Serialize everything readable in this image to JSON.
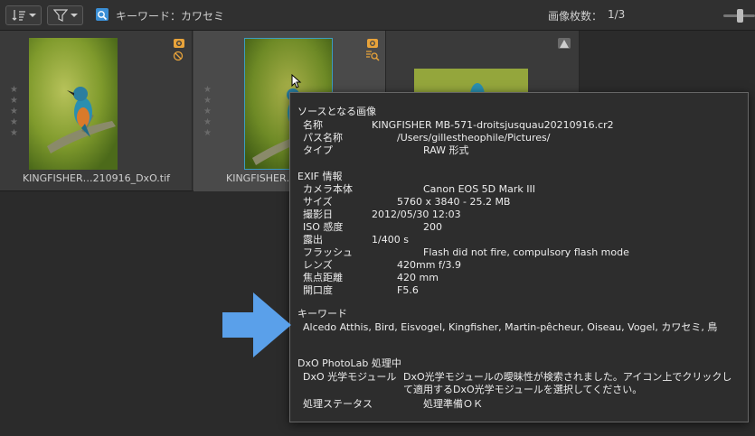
{
  "toolbar": {
    "keyword_label": "キーワード：カワセミ",
    "image_count_label": "画像枚数：",
    "image_count_value": "1/3"
  },
  "thumbnails": [
    {
      "label": "KINGFISHER…210916_DxO.tif"
    },
    {
      "label": "KINGFISHER…d"
    },
    {
      "label": ""
    }
  ],
  "info": {
    "source": {
      "title": "ソースとなる画像",
      "rows": [
        {
          "key": "名称",
          "value": "KINGFISHER MB-571-droitsjusquau20210916.cr2"
        },
        {
          "key": "パス名称",
          "value": "/Users/gillestheophile/Pictures/"
        },
        {
          "key": "タイプ",
          "value": "RAW 形式"
        }
      ]
    },
    "exif": {
      "title": "EXIF 情報",
      "rows": [
        {
          "key": "カメラ本体",
          "value": "Canon EOS 5D Mark III"
        },
        {
          "key": "サイズ",
          "value": "5760 x 3840 - 25.2 MB"
        },
        {
          "key": "撮影日",
          "value": "2012/05/30 12:03"
        },
        {
          "key": "ISO 感度",
          "value": "200"
        },
        {
          "key": "露出",
          "value": "1/400 s"
        },
        {
          "key": "フラッシュ",
          "value": "Flash did not fire, compulsory flash mode"
        },
        {
          "key": "レンズ",
          "value": "420mm f/3.9"
        },
        {
          "key": "焦点距離",
          "value": "420 mm"
        },
        {
          "key": "開口度",
          "value": "F5.6"
        }
      ]
    },
    "keywords": {
      "title": "キーワード",
      "text": "Alcedo Atthis, Bird, Eisvogel, Kingfisher, Martin-pêcheur, Oiseau, Vogel, カワセミ, 鳥"
    },
    "processing": {
      "title": "DxO PhotoLab 処理中",
      "module_key": "DxO 光学モジュール",
      "module_value": "DxO光学モジュールの曖昧性が検索されました。アイコン上でクリックして適用するDxO光学モジュールを選択してください。",
      "status_key": "処理ステータス",
      "status_value": "処理準備ＯＫ"
    }
  },
  "colors": {
    "accent_blue": "#3b8fd6",
    "badge_orange": "#e8a33a",
    "arrow_blue": "#5aa0ea"
  }
}
